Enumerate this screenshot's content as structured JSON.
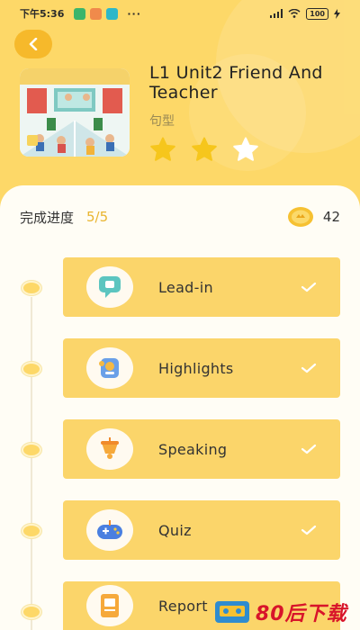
{
  "status_bar": {
    "time": "下午5:36",
    "dots": "···",
    "battery": "100"
  },
  "lesson": {
    "title": "L1 Unit2 Friend And Teacher",
    "type": "句型",
    "stars_earned": 2,
    "stars_total": 3
  },
  "progress": {
    "label": "完成进度",
    "value": "5/5",
    "coins": "42"
  },
  "steps": [
    {
      "label": "Lead-in",
      "icon": "chat-bubble-icon",
      "completed": true
    },
    {
      "label": "Highlights",
      "icon": "highlights-icon",
      "completed": true
    },
    {
      "label": "Speaking",
      "icon": "megaphone-icon",
      "completed": true
    },
    {
      "label": "Quiz",
      "icon": "gamepad-icon",
      "completed": true
    },
    {
      "label": "Report",
      "icon": "report-icon",
      "completed": true
    }
  ],
  "watermark": {
    "text": "80后下载"
  },
  "colors": {
    "background": "#fdd868",
    "card": "#fbd56a",
    "accent": "#f6b92b",
    "progress_accent": "#e9b530",
    "star_filled": "#f6c61c",
    "star_empty": "#ffffff"
  }
}
